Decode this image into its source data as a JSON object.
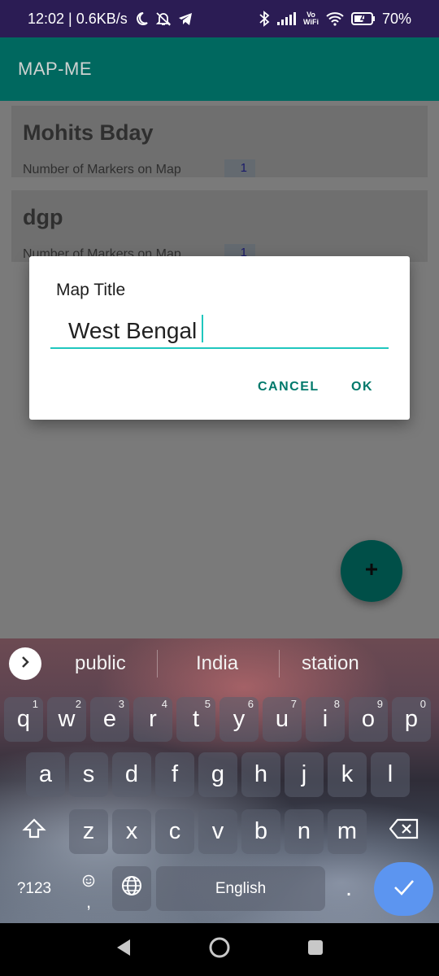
{
  "status_bar": {
    "time_speed": "12:02 | 0.6KB/s",
    "wifi_label_top": "Vo",
    "wifi_label_bottom": "WiFi",
    "battery": "70%",
    "icons": [
      "moon-icon",
      "bell-off-icon",
      "telegram-icon",
      "bluetooth-icon",
      "signal-icon",
      "vowifi-icon",
      "wifi-icon",
      "battery-icon"
    ]
  },
  "app_bar": {
    "title": "MAP-ME"
  },
  "cards": [
    {
      "title": "Mohits Bday",
      "subtitle": "Number of Markers on Map",
      "count": "1"
    },
    {
      "title": "dgp",
      "subtitle": "Number of Markers on Map",
      "count": "1"
    }
  ],
  "dialog": {
    "title": "Map Title",
    "input_value": "West Bengal",
    "cancel_label": "CANCEL",
    "ok_label": "OK"
  },
  "fab": {
    "icon": "plus-icon"
  },
  "keyboard": {
    "suggestions": [
      "public",
      "India",
      "station"
    ],
    "row1": [
      {
        "label": "q",
        "hint": "1"
      },
      {
        "label": "w",
        "hint": "2"
      },
      {
        "label": "e",
        "hint": "3"
      },
      {
        "label": "r",
        "hint": "4"
      },
      {
        "label": "t",
        "hint": "5"
      },
      {
        "label": "y",
        "hint": "6"
      },
      {
        "label": "u",
        "hint": "7"
      },
      {
        "label": "i",
        "hint": "8"
      },
      {
        "label": "o",
        "hint": "9"
      },
      {
        "label": "p",
        "hint": "0"
      }
    ],
    "row2": [
      "a",
      "s",
      "d",
      "f",
      "g",
      "h",
      "j",
      "k",
      "l"
    ],
    "row3": [
      "z",
      "x",
      "c",
      "v",
      "b",
      "n",
      "m"
    ],
    "symbols_label": "?123",
    "comma_label": ",",
    "space_label": "English",
    "period_label": ".",
    "icons": [
      "shift-icon",
      "backspace-icon",
      "emoji-icon",
      "globe-icon",
      "check-icon",
      "chevron-right-icon"
    ]
  },
  "nav_bar": {
    "icons": [
      "back-icon",
      "home-icon",
      "recents-icon"
    ]
  },
  "colors": {
    "status_bar": "#2b1c54",
    "app_bar": "#00685f",
    "accent": "#20c7be",
    "dialog_button": "#00796b",
    "fab": "#004f48",
    "enter_key": "#5c95f0"
  }
}
